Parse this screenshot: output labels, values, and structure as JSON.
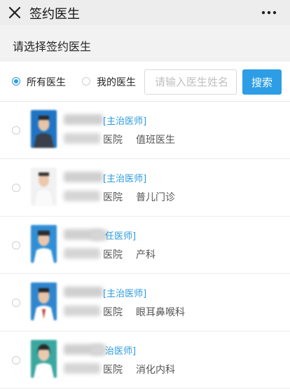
{
  "topbar": {
    "title": "签约医生"
  },
  "subheader": {
    "text": "请选择签约医生"
  },
  "filter": {
    "options": [
      {
        "label": "所有医生",
        "selected": true
      },
      {
        "label": "我的医生",
        "selected": false
      }
    ],
    "search_placeholder": "请输入医生姓名",
    "search_button": "搜索"
  },
  "doctors": [
    {
      "title": "[主治医师]",
      "hospital": "医院",
      "department": "值班医生",
      "photo_bg": "#1f74c4"
    },
    {
      "title": "[主治医师]",
      "hospital": "医院",
      "department": "普儿门诊",
      "photo_bg": "#f2f2f2"
    },
    {
      "title": "任医师]",
      "hospital": "医院",
      "department": "产科",
      "photo_bg": "#2f8fd6"
    },
    {
      "title": "[主治医师]",
      "hospital": "医院",
      "department": "眼耳鼻喉科",
      "photo_bg": "#2f86cf"
    },
    {
      "title": "治医师]",
      "hospital": "医院",
      "department": "消化内科",
      "photo_bg": "#3aa7a0"
    }
  ],
  "colors": {
    "accent": "#2d9ee5"
  }
}
